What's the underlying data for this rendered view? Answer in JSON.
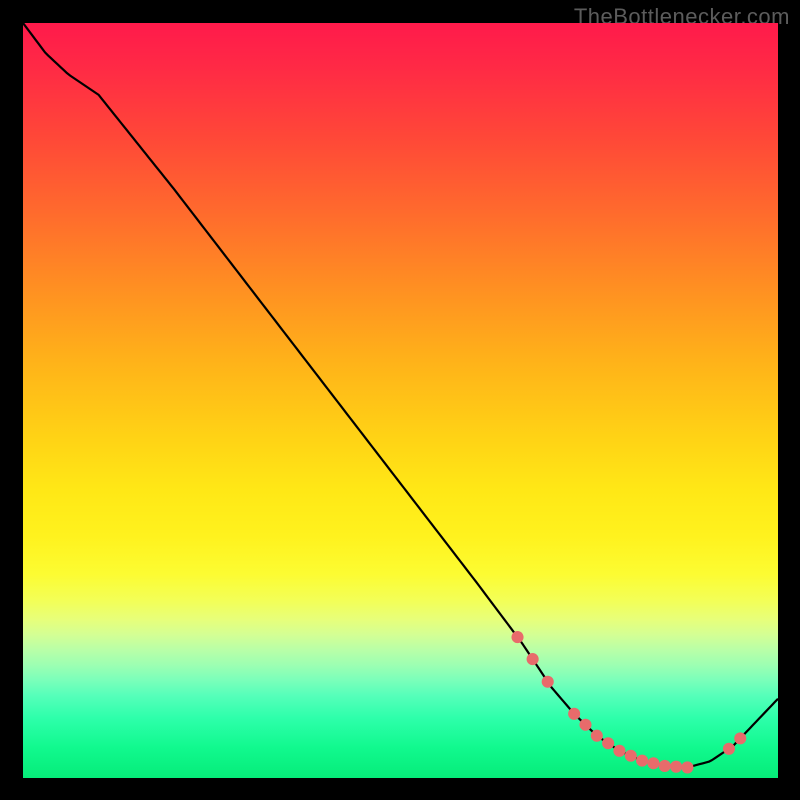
{
  "watermark": "TheBottlenecker.com",
  "chart_data": {
    "type": "line",
    "title": "",
    "xlabel": "",
    "ylabel": "",
    "xlim": [
      0,
      100
    ],
    "ylim": [
      0,
      100
    ],
    "grid": false,
    "series": [
      {
        "name": "curve",
        "x": [
          0,
          3,
          6,
          10,
          20,
          30,
          40,
          50,
          60,
          66,
          70,
          73,
          76,
          79,
          82,
          85,
          88,
          91,
          94,
          100
        ],
        "y": [
          100,
          96,
          93.2,
          90.5,
          78,
          65,
          52,
          39,
          26,
          18,
          12,
          8.5,
          5.6,
          3.6,
          2.3,
          1.6,
          1.4,
          2.2,
          4.2,
          10.5
        ]
      }
    ],
    "markers": {
      "series": "curve",
      "color": "#e86b6b",
      "radius_rel": 0.008,
      "x": [
        65.5,
        67.5,
        69.5,
        73.0,
        74.5,
        76.0,
        77.5,
        79.0,
        80.5,
        82.0,
        83.5,
        85.0,
        86.5,
        88.0,
        93.5,
        95.0
      ]
    },
    "background_gradient": {
      "top": "#ff1a4b",
      "mid": "#fff21e",
      "bottom": "#06ec79"
    }
  }
}
